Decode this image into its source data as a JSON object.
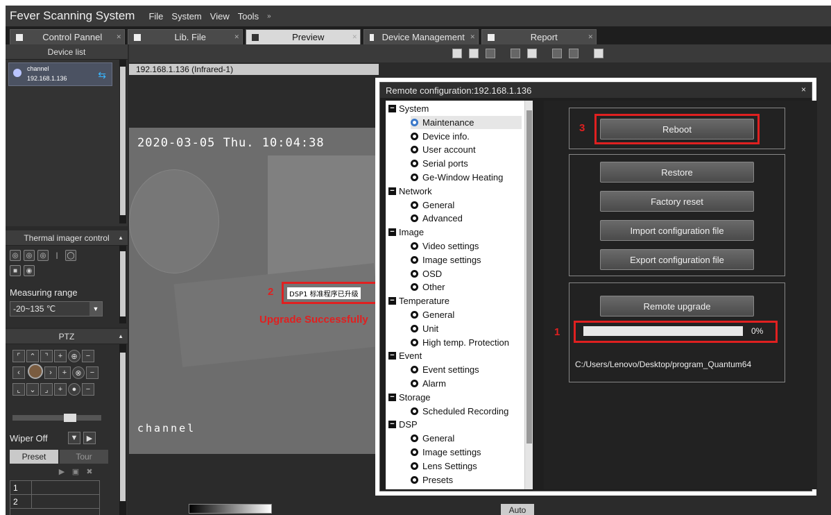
{
  "app": {
    "title": "Fever Scanning System",
    "menu": [
      "File",
      "System",
      "View",
      "Tools"
    ],
    "menu_more": "»"
  },
  "tabs": [
    {
      "label": "Control Pannel",
      "active": false
    },
    {
      "label": "Lib. File",
      "active": false
    },
    {
      "label": "Preview",
      "active": true
    },
    {
      "label": "Device Management",
      "active": false
    },
    {
      "label": "Report",
      "active": false
    }
  ],
  "device_list": {
    "header": "Device list",
    "item": {
      "name": "channel",
      "ip": "192.168.1.136"
    }
  },
  "thermal_control": {
    "header": "Thermal imager control",
    "measuring_label": "Measuring range",
    "range_value": "-20~135 ℃"
  },
  "ptz": {
    "header": "PTZ",
    "wiper_label": "Wiper Off",
    "preset_tab": "Preset",
    "tour_tab": "Tour",
    "rows": [
      "1",
      "2"
    ]
  },
  "preview": {
    "channel_title": "192.168.1.136 (Infrared-1)",
    "timestamp": "2020-03-05 Thu. 10:04:38",
    "osd_channel": "channel",
    "upgrade_osd": "DSP1 标准程序已升级",
    "annotation_2": "2",
    "upgrade_success": "Upgrade Successfully",
    "auto_button": "Auto"
  },
  "dialog": {
    "title": "Remote configuration:192.168.1.136",
    "close": "×",
    "tree": [
      {
        "type": "group",
        "label": "System"
      },
      {
        "type": "leaf",
        "label": "Maintenance",
        "selected": true
      },
      {
        "type": "leaf",
        "label": "Device info."
      },
      {
        "type": "leaf",
        "label": "User account"
      },
      {
        "type": "leaf",
        "label": "Serial ports"
      },
      {
        "type": "leaf",
        "label": "Ge-Window Heating"
      },
      {
        "type": "group",
        "label": "Network"
      },
      {
        "type": "leaf",
        "label": "General"
      },
      {
        "type": "leaf",
        "label": "Advanced"
      },
      {
        "type": "group",
        "label": "Image"
      },
      {
        "type": "leaf",
        "label": "Video settings"
      },
      {
        "type": "leaf",
        "label": "Image settings"
      },
      {
        "type": "leaf",
        "label": "OSD"
      },
      {
        "type": "leaf",
        "label": "Other"
      },
      {
        "type": "group",
        "label": "Temperature"
      },
      {
        "type": "leaf",
        "label": "General"
      },
      {
        "type": "leaf",
        "label": "Unit"
      },
      {
        "type": "leaf",
        "label": "High temp. Protection"
      },
      {
        "type": "group",
        "label": "Event"
      },
      {
        "type": "leaf",
        "label": "Event settings"
      },
      {
        "type": "leaf",
        "label": "Alarm"
      },
      {
        "type": "group",
        "label": "Storage"
      },
      {
        "type": "leaf",
        "label": "Scheduled Recording"
      },
      {
        "type": "group",
        "label": "DSP"
      },
      {
        "type": "leaf",
        "label": "General"
      },
      {
        "type": "leaf",
        "label": "Image settings"
      },
      {
        "type": "leaf",
        "label": "Lens Settings"
      },
      {
        "type": "leaf",
        "label": "Presets"
      }
    ],
    "buttons": {
      "reboot": "Reboot",
      "restore": "Restore",
      "factory_reset": "Factory reset",
      "import_config": "Import configuration file",
      "export_config": "Export configuration file",
      "remote_upgrade": "Remote upgrade"
    },
    "annotation_1": "1",
    "annotation_3": "3",
    "progress": {
      "value": 0,
      "text": "0%"
    },
    "file_path": "C:/Users/Lenovo/Desktop/program_Quantum64"
  },
  "colors": {
    "annotation_red": "#e02020",
    "accent_blue": "#38b6ff"
  }
}
